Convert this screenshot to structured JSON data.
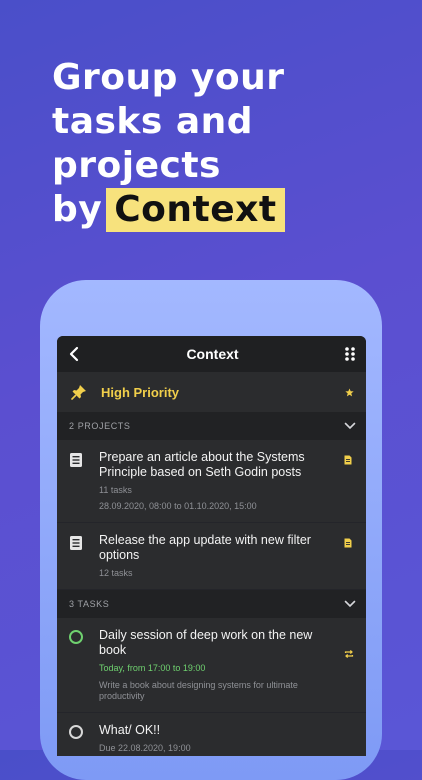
{
  "hero": {
    "line1": "Group your",
    "line2": "tasks and",
    "line3": "projects",
    "line4_prefix": "by",
    "line4_highlight": "Context"
  },
  "screen": {
    "title": "Context",
    "context_name": "High Priority",
    "projects_header": "2 PROJECTS",
    "tasks_header": "3 TASKS"
  },
  "projects": [
    {
      "title": "Prepare an article about the Systems Principle based on Seth Godin posts",
      "count": "11 tasks",
      "dates": "28.09.2020, 08:00 to 01.10.2020, 15:00"
    },
    {
      "title": "Release the app update with new filter options",
      "count": "12 tasks"
    }
  ],
  "tasks": [
    {
      "title": "Daily session of deep work on the new book",
      "schedule": "Today, from 17:00 to 19:00",
      "note": "Write a book about designing systems for ultimate productivity"
    },
    {
      "title": "What/ OK!!",
      "due": "Due 22.08.2020, 19:00"
    }
  ],
  "colors": {
    "background": "#5050cc",
    "highlight": "#f7e27d",
    "accent_yellow": "#f1cf4b",
    "accent_green": "#6fd16f",
    "screen_bg": "#2b2c2e"
  },
  "icons": {
    "back": "chevron-left-icon",
    "menu": "dots-grid-icon",
    "context": "pin-icon",
    "star": "star-icon",
    "expand": "chevron-down-icon",
    "project": "document-icon",
    "note": "note-icon",
    "repeat": "repeat-icon"
  }
}
